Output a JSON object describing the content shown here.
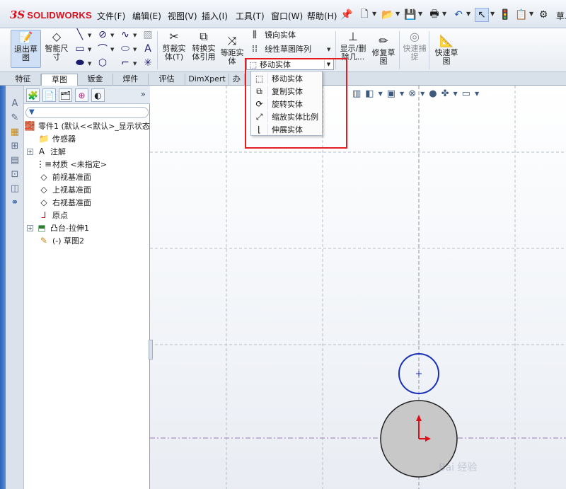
{
  "app": {
    "logo_mark": "3S",
    "logo_text": "SOLIDWORKS",
    "doc_short": "草."
  },
  "menu": [
    {
      "label": "文件(F)"
    },
    {
      "label": "编辑(E)"
    },
    {
      "label": "视图(V)"
    },
    {
      "label": "插入(I)"
    },
    {
      "label": "工具(T)"
    },
    {
      "label": "窗口(W)"
    },
    {
      "label": "帮助(H)"
    }
  ],
  "ribbon": {
    "exit_sketch": "退出草图",
    "smart_dim": "智能尺寸",
    "trim": "剪裁实体(T)",
    "convert": "转换实体引用",
    "offset": "等距实体",
    "mirror": "镜向实体",
    "linear_pattern": "线性草图阵列",
    "move_combo": "移动实体",
    "show_delete": "显示/删除几...",
    "repair": "修复草图",
    "quick_snap": "快速捕捉",
    "rapid_sketch": "快速草图"
  },
  "tabs": [
    "特征",
    "草图",
    "钣金",
    "焊件",
    "评估",
    "DimXpert",
    "办公"
  ],
  "active_tab": "草图",
  "dropdown": {
    "items": [
      {
        "label": "移动实体",
        "icon": "move-entities-icon"
      },
      {
        "label": "复制实体",
        "icon": "copy-entities-icon"
      },
      {
        "label": "旋转实体",
        "icon": "rotate-entities-icon"
      },
      {
        "label": "缩放实体比例",
        "icon": "scale-entities-icon"
      },
      {
        "label": "伸展实体",
        "icon": "stretch-entities-icon"
      }
    ],
    "highlight_color": "#e21e25"
  },
  "tree": {
    "root": "零件1 (默认<<默认>_显示状态",
    "items": [
      {
        "label": "传感器",
        "icon": "sensor-folder-icon",
        "expandable": false
      },
      {
        "label": "注解",
        "icon": "annotations-icon",
        "expandable": true
      },
      {
        "label": "材质 <未指定>",
        "icon": "material-icon",
        "expandable": false
      },
      {
        "label": "前视基准面",
        "icon": "plane-icon",
        "expandable": false
      },
      {
        "label": "上视基准面",
        "icon": "plane-icon",
        "expandable": false
      },
      {
        "label": "右视基准面",
        "icon": "plane-icon",
        "expandable": false
      },
      {
        "label": "原点",
        "icon": "origin-icon",
        "expandable": false
      },
      {
        "label": "凸台-拉伸1",
        "icon": "extrude-icon",
        "expandable": true
      },
      {
        "label": "(-) 草图2",
        "icon": "sketch-icon",
        "expandable": false
      }
    ]
  },
  "colors": {
    "sketch_circle": "#1a2fb8",
    "solid_fill": "#c8c8c8",
    "origin_red": "#e0101a",
    "grid_line": "#b8bec8",
    "axis_line": "#9a7ab0"
  },
  "watermark": "Bai 经验"
}
